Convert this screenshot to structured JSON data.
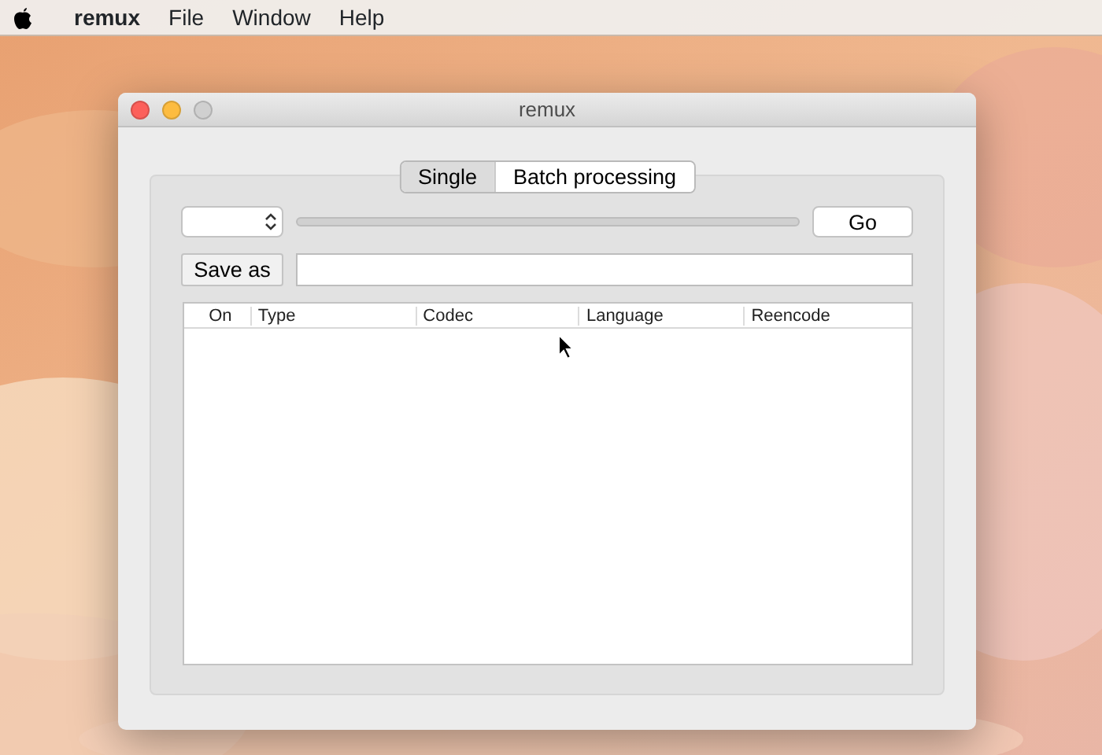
{
  "menu_bar": {
    "app_name": "remux",
    "items": [
      "File",
      "Window",
      "Help"
    ]
  },
  "window": {
    "title": "remux",
    "buttons": [
      {
        "color": "#fc605b"
      },
      {
        "color": "#fdbc40"
      },
      {
        "color": "#d0d0d0"
      }
    ]
  },
  "tabs": [
    {
      "label": "Single",
      "selected": true
    },
    {
      "label": "Batch processing",
      "selected": false
    }
  ],
  "progress": {
    "level": 0
  },
  "go_button": "Go",
  "save_as_button": "Save as",
  "table": {
    "columns": [
      "On",
      "Type",
      "Codec",
      "Language",
      "Reencode"
    ]
  }
}
